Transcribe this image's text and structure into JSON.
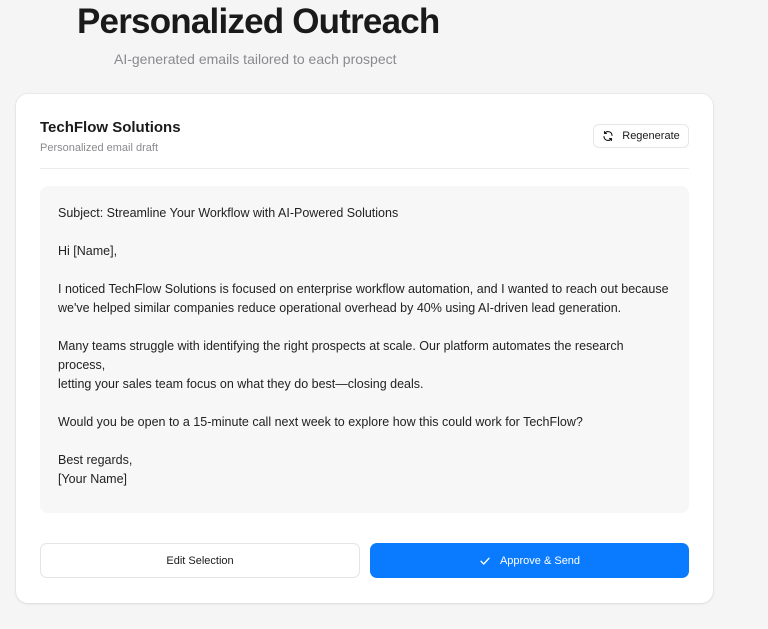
{
  "header": {
    "title": "Personalized Outreach",
    "subtitle": "AI-generated emails tailored to each prospect"
  },
  "card": {
    "company": "TechFlow Solutions",
    "draft_label": "Personalized email draft",
    "regenerate_label": "Regenerate",
    "regenerate_icon": "refresh-icon"
  },
  "email": {
    "subject": "Subject: Streamline Your Workflow with AI-Powered Solutions",
    "greeting": "Hi [Name],",
    "paragraph1": "I noticed TechFlow Solutions is focused on enterprise workflow automation, and I wanted to reach out because\nwe've helped similar companies reduce operational overhead by 40% using AI-driven lead generation.",
    "paragraph2": "Many teams struggle with identifying the right prospects at scale. Our platform automates the research process,\nletting your sales team focus on what they do best—closing deals.",
    "paragraph3": "Would you be open to a 15-minute call next week to explore how this could work for TechFlow?",
    "signoff": "Best regards,\n[Your Name]"
  },
  "actions": {
    "edit_label": "Edit Selection",
    "approve_label": "Approve & Send",
    "approve_icon": "check-icon"
  },
  "colors": {
    "accent": "#0a7bff",
    "background": "#f5f5f5",
    "email_box": "#f7f7f7"
  }
}
